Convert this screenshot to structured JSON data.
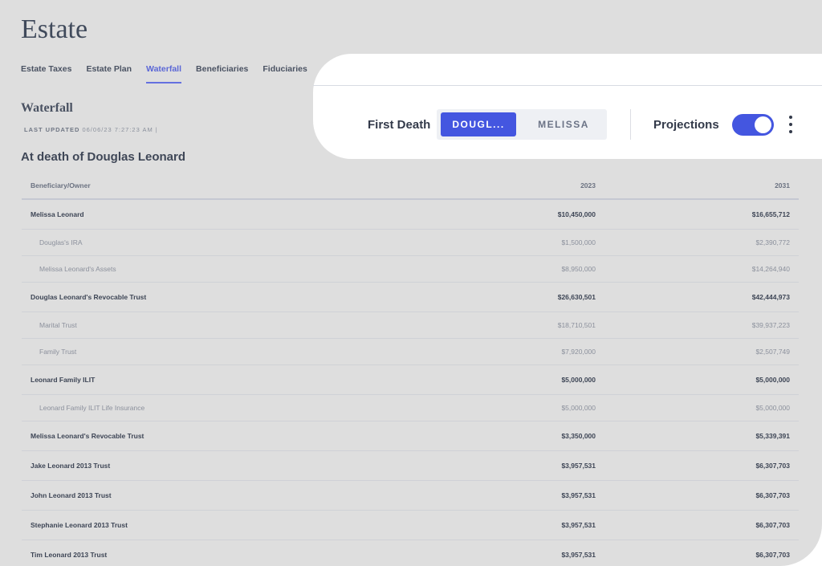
{
  "app": {
    "title": "Estate"
  },
  "tabs": [
    {
      "label": "Estate Taxes",
      "active": false
    },
    {
      "label": "Estate Plan",
      "active": false
    },
    {
      "label": "Waterfall",
      "active": true
    },
    {
      "label": "Beneficiaries",
      "active": false
    },
    {
      "label": "Fiduciaries",
      "active": false
    }
  ],
  "section": {
    "title": "Waterfall",
    "last_updated_label": "LAST UPDATED",
    "last_updated_value": "06/06/23 7:27:23 AM |"
  },
  "death_heading": "At death of Douglas Leonard",
  "table": {
    "headers": {
      "name": "Beneficiary/Owner",
      "y1": "2023",
      "y2": "2031"
    },
    "rows": [
      {
        "name": "Melissa Leonard",
        "v1": "$10,450,000",
        "v2": "$16,655,712",
        "level": "parent"
      },
      {
        "name": "Douglas's IRA",
        "v1": "$1,500,000",
        "v2": "$2,390,772",
        "level": "child"
      },
      {
        "name": "Melissa Leonard's Assets",
        "v1": "$8,950,000",
        "v2": "$14,264,940",
        "level": "child"
      },
      {
        "name": "Douglas Leonard's Revocable Trust",
        "v1": "$26,630,501",
        "v2": "$42,444,973",
        "level": "parent"
      },
      {
        "name": "Marital Trust",
        "v1": "$18,710,501",
        "v2": "$39,937,223",
        "level": "child"
      },
      {
        "name": "Family Trust",
        "v1": "$7,920,000",
        "v2": "$2,507,749",
        "level": "child"
      },
      {
        "name": "Leonard Family ILIT",
        "v1": "$5,000,000",
        "v2": "$5,000,000",
        "level": "parent"
      },
      {
        "name": "Leonard Family ILIT Life Insurance",
        "v1": "$5,000,000",
        "v2": "$5,000,000",
        "level": "child"
      },
      {
        "name": "Melissa Leonard's Revocable Trust",
        "v1": "$3,350,000",
        "v2": "$5,339,391",
        "level": "parent"
      },
      {
        "name": "Jake Leonard 2013 Trust",
        "v1": "$3,957,531",
        "v2": "$6,307,703",
        "level": "parent"
      },
      {
        "name": "John Leonard 2013 Trust",
        "v1": "$3,957,531",
        "v2": "$6,307,703",
        "level": "parent"
      },
      {
        "name": "Stephanie Leonard 2013 Trust",
        "v1": "$3,957,531",
        "v2": "$6,307,703",
        "level": "parent"
      },
      {
        "name": "Tim Leonard 2013 Trust",
        "v1": "$3,957,531",
        "v2": "$6,307,703",
        "level": "parent"
      }
    ]
  },
  "toolbar": {
    "first_death_label": "First Death",
    "options": [
      {
        "label": "DOUGL...",
        "active": true
      },
      {
        "label": "MELISSA",
        "active": false
      }
    ],
    "projections_label": "Projections",
    "projections_on": true,
    "more_icon": "more-vertical-icon"
  },
  "colors": {
    "accent": "#4456e0",
    "active_tab": "#5b67d6",
    "background": "#dedede"
  }
}
